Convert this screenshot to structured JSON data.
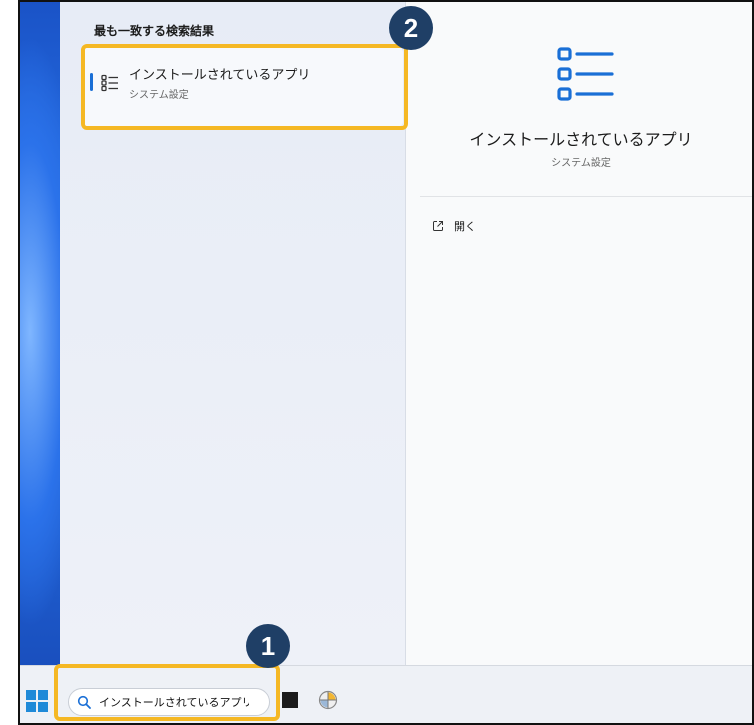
{
  "search_results": {
    "section_title": "最も一致する検索結果",
    "best_match": {
      "title": "インストールされているアプリ",
      "subtitle": "システム設定"
    }
  },
  "detail": {
    "title": "インストールされているアプリ",
    "subtitle": "システム設定",
    "actions": [
      {
        "label": "開く",
        "icon": "open-external-icon"
      }
    ]
  },
  "taskbar": {
    "search": {
      "value": "インストールされているアプリ",
      "icon": "search-icon"
    }
  },
  "callouts": [
    {
      "number": "1"
    },
    {
      "number": "2"
    }
  ],
  "colors": {
    "accent": "#1a6fd6",
    "highlight": "#f5b824",
    "badge": "#1f3f66"
  }
}
